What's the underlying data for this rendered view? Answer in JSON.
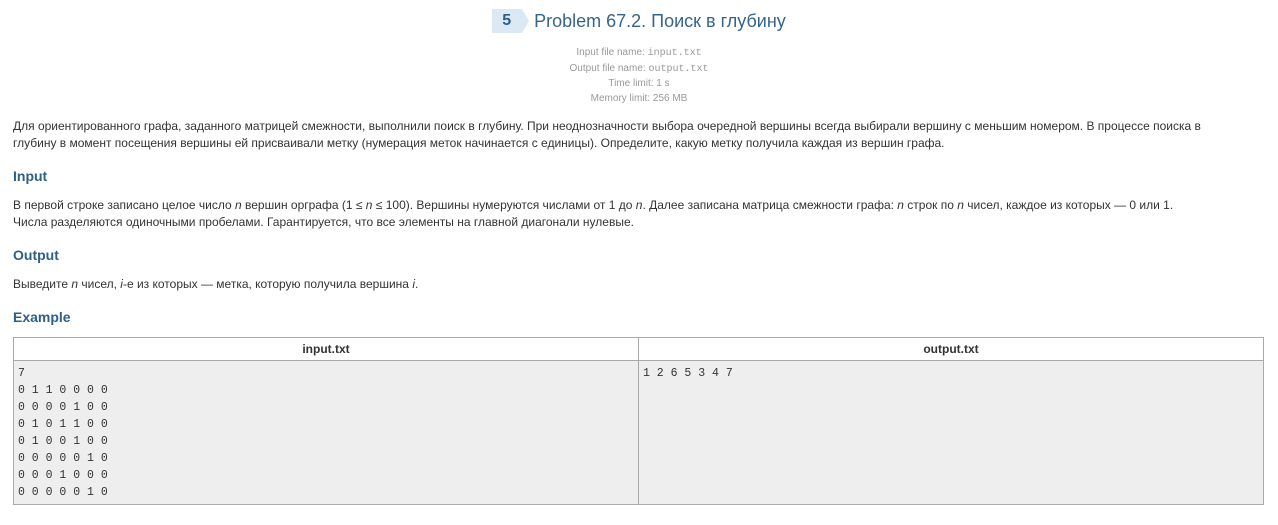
{
  "problem": {
    "number": "5",
    "title": "Problem 67.2. Поиск в глубину"
  },
  "limits": {
    "input_label": "Input file name: ",
    "input_file": "input.txt",
    "output_label": "Output file name: ",
    "output_file": "output.txt",
    "time_limit": "Time limit: 1 s",
    "memory_limit": "Memory limit: 256 MB"
  },
  "statement": {
    "line1": "Для ориентированного графа, заданного матрицей смежности, выполнили поиск в глубину. При неоднозначности выбора очередной вершины всегда выбирали вершину с меньшим номером. В процессе поиска в",
    "line2": "глубину в момент посещения вершины ей присваивали метку (нумерация меток начинается с единицы). Определите, какую метку получила каждая из вершин графа."
  },
  "input_section": {
    "heading": "Input",
    "t1": "В первой строке записано целое число ",
    "n1": "n",
    "t2": " вершин орграфа (1 ≤ ",
    "n2": "n",
    "t3": " ≤ 100). Вершины нумеруются числами от 1 до ",
    "n3": "n",
    "t4": ". Далее записана матрица смежности графа: ",
    "n4": "n",
    "t5": " строк по ",
    "n5": "n",
    "t6": " чисел, каждое из которых — 0 или 1.",
    "line2": "Числа разделяются одиночными пробелами. Гарантируется, что все элементы на главной диагонали нулевые."
  },
  "output_section": {
    "heading": "Output",
    "t1": "Выведите ",
    "n1": "n",
    "t2": " чисел, ",
    "i1": "i",
    "t3": "-е из которых — метка, которую получила вершина ",
    "i2": "i",
    "t4": "."
  },
  "example": {
    "heading": "Example",
    "input_header": "input.txt",
    "output_header": "output.txt",
    "input_content": "7\n0 1 1 0 0 0 0\n0 0 0 0 1 0 0\n0 1 0 1 1 0 0\n0 1 0 0 1 0 0\n0 0 0 0 0 1 0\n0 0 0 1 0 0 0\n0 0 0 0 0 1 0",
    "output_content": "1 2 6 5 3 4 7"
  }
}
